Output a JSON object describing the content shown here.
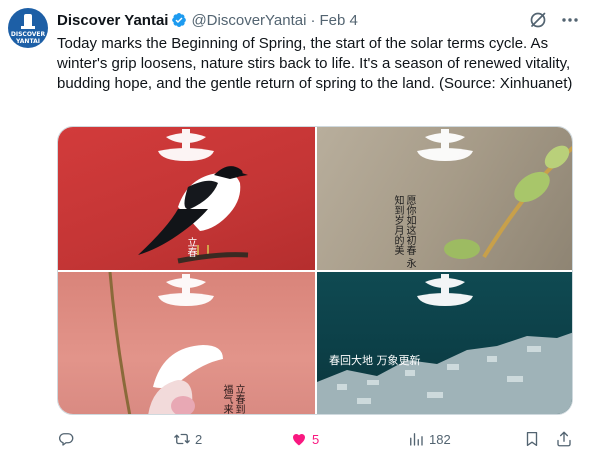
{
  "author": {
    "display_name": "Discover Yantai",
    "handle": "@DiscoverYantai",
    "separator": "·",
    "date": "Feb 4",
    "avatar_text_line1": "DISCOVER",
    "avatar_text_line2": "YANTAI",
    "avatar_color": "#1d5fa6",
    "verified_color": "#1d9bf0"
  },
  "tweet": {
    "text": "Today marks the Beginning of Spring, the start of the solar terms cycle. As winter's grip loosens, nature stirs back to life. It's a season of renewed vitality, budding hope, and the gentle return of spring to the land. (Source: Xinhuanet)"
  },
  "media": {
    "images": [
      {
        "label": "magpie",
        "caption_text": "立春"
      },
      {
        "label": "buds",
        "caption_text": "愿你如这初春 永知到岁月的美"
      },
      {
        "label": "snow-flower",
        "caption_text": "立春到 福气来"
      },
      {
        "label": "ice",
        "caption_text": "春回大地 万象更新"
      }
    ]
  },
  "actions": {
    "reply": {
      "icon": "reply-icon",
      "count": ""
    },
    "repost": {
      "icon": "repost-icon",
      "count": "2"
    },
    "like": {
      "icon": "heart-icon",
      "count": "5",
      "color": "#f91880"
    },
    "views": {
      "icon": "views-icon",
      "count": "182"
    },
    "bookmark": {
      "icon": "bookmark-icon"
    },
    "share": {
      "icon": "share-icon"
    }
  }
}
